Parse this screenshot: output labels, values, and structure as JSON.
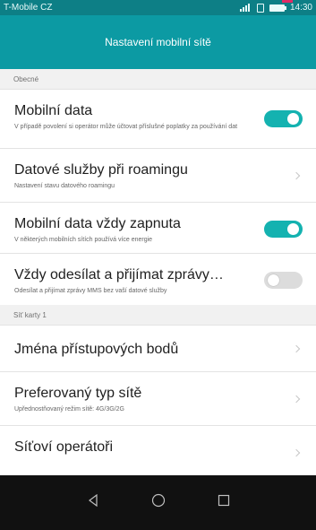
{
  "status_bar": {
    "carrier": "T-Mobile CZ",
    "time": "14:30",
    "icons": [
      "signal-icon",
      "sim-icon",
      "battery-icon"
    ],
    "notification_color": "#e02b66"
  },
  "app_bar": {
    "title": "Nastavení mobilní sítě",
    "color": "#0c9aa3"
  },
  "sections": [
    {
      "label": "Obecné",
      "items": [
        {
          "title": "Mobilní data",
          "subtitle": "V případě povolení si operátor může účtovat příslušné poplatky za používání dat",
          "control": "toggle",
          "state": "on"
        },
        {
          "title": "Datové služby při roamingu",
          "subtitle": "Nastavení stavu datového roamingu",
          "control": "chevron"
        },
        {
          "title": "Mobilní data vždy zapnuta",
          "subtitle": "V některých mobilních sítích používá více energie",
          "control": "toggle",
          "state": "on"
        },
        {
          "title": "Vždy odesílat a přijímat zprávy…",
          "subtitle": "Odesílat a přijímat zprávy MMS bez vaší datové služby",
          "control": "toggle",
          "state": "off"
        }
      ]
    },
    {
      "label": "Síť karty 1",
      "items": [
        {
          "title": "Jména přístupových bodů",
          "subtitle": "",
          "control": "chevron"
        },
        {
          "title": "Preferovaný typ sítě",
          "subtitle": "Upřednostňovaný režim sítě: 4G/3G/2G",
          "control": "chevron"
        },
        {
          "title": "Síťoví operátoři",
          "subtitle": "",
          "control": "chevron"
        }
      ]
    }
  ],
  "nav_bar": {
    "buttons": [
      "back-icon",
      "home-icon",
      "recent-apps-icon"
    ]
  },
  "toggle_on_color": "#14b2b0",
  "toggle_off_color": "#dcdcdc"
}
